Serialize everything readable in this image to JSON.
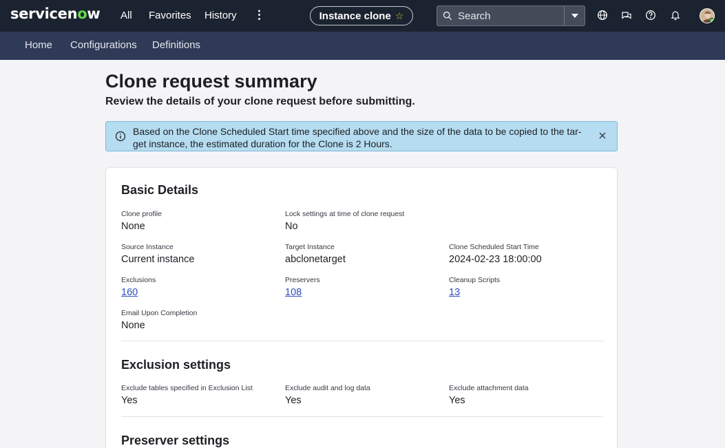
{
  "header": {
    "logo_prefix": "servicen",
    "logo_o": "o",
    "logo_suffix": "w",
    "nav": {
      "all": "All",
      "favorites": "Favorites",
      "history": "History",
      "more": "⋮"
    },
    "context_pill": "Instance clone",
    "star": "☆",
    "search_placeholder": "Search"
  },
  "subnav": {
    "home": "Home",
    "configurations": "Configurations",
    "definitions": "Definitions"
  },
  "page": {
    "title": "Clone request summary",
    "subtitle": "Review the details of your clone request before submitting."
  },
  "banner": {
    "message": "Based on the Clone Scheduled Start time specified above and the size of the data to be copied to the tar- get instance, the estimated duration for the Clone is 2 Hours."
  },
  "basic_details": {
    "title": "Basic Details",
    "clone_profile": {
      "label": "Clone profile",
      "value": "None"
    },
    "lock_settings": {
      "label": "Lock settings at time of clone request",
      "value": "No"
    },
    "source_instance": {
      "label": "Source Instance",
      "value": "Current instance"
    },
    "target_instance": {
      "label": "Target Instance",
      "value": "abclonetarget"
    },
    "scheduled_start": {
      "label": "Clone Scheduled Start Time",
      "value": "2024-02-23 18:00:00"
    },
    "exclusions": {
      "label": "Exclusions",
      "value": "160"
    },
    "preservers": {
      "label": "Preservers",
      "value": "108"
    },
    "cleanup_scripts": {
      "label": "Cleanup Scripts",
      "value": "13"
    },
    "email_upon_completion": {
      "label": "Email Upon Completion",
      "value": "None"
    }
  },
  "exclusion_settings": {
    "title": "Exclusion settings",
    "exclude_tables": {
      "label": "Exclude tables specified in Exclusion List",
      "value": "Yes"
    },
    "exclude_audit": {
      "label": "Exclude audit and log data",
      "value": "Yes"
    },
    "exclude_attachment": {
      "label": "Exclude attachment data",
      "value": "Yes"
    }
  },
  "preserver_settings": {
    "title": "Preserver settings"
  },
  "colors": {
    "header_bg": "#1c2330",
    "subnav_bg": "#2e3a56",
    "brand_accent": "#62d84e",
    "banner_bg": "#b5dcf0",
    "link": "#2d4fc2"
  },
  "icons": [
    "search-icon",
    "dropdown-caret-icon",
    "globe-icon",
    "chat-icon",
    "help-icon",
    "bell-icon",
    "info-icon",
    "close-icon",
    "star-icon"
  ]
}
